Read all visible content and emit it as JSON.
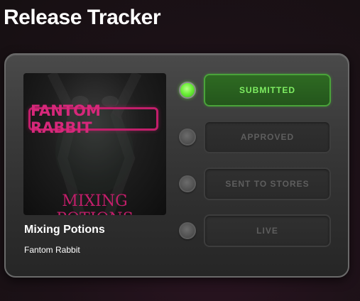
{
  "page": {
    "title": "Release Tracker"
  },
  "release": {
    "cover_artist_text": "Fantom Rabbit",
    "cover_title_text": "Mixing Potions",
    "title": "Mixing Potions",
    "artist": "Fantom Rabbit"
  },
  "stages": [
    {
      "label": "SUBMITTED",
      "active": true
    },
    {
      "label": "APPROVED",
      "active": false
    },
    {
      "label": "SENT TO STORES",
      "active": false
    },
    {
      "label": "LIVE",
      "active": false
    }
  ],
  "colors": {
    "active_green": "#6ef03a",
    "active_button_bg": "#2e6a22",
    "cover_accent": "#c21e6a"
  }
}
